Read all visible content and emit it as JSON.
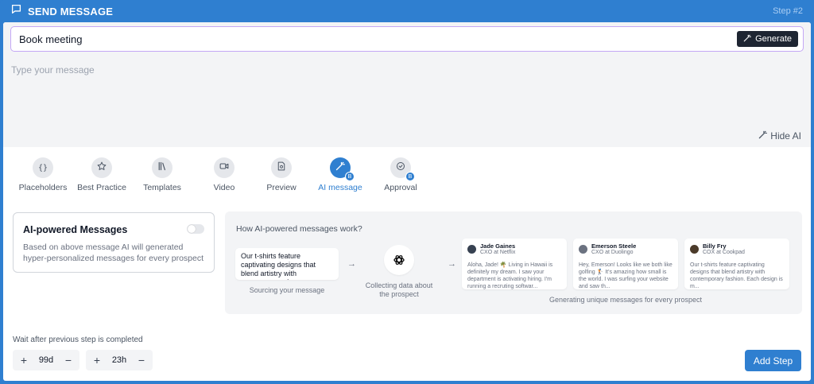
{
  "header": {
    "title": "SEND MESSAGE",
    "step": "Step #2"
  },
  "subject": {
    "value": "Book meeting",
    "generate_label": "Generate"
  },
  "message": {
    "placeholder": "Type your message"
  },
  "hide_ai_label": "Hide AI",
  "tools": [
    {
      "label": "Placeholders",
      "icon": "braces-icon"
    },
    {
      "label": "Best Practice",
      "icon": "star-icon"
    },
    {
      "label": "Templates",
      "icon": "library-icon"
    },
    {
      "label": "Video",
      "icon": "video-icon"
    },
    {
      "label": "Preview",
      "icon": "document-search-icon"
    },
    {
      "label": "AI message",
      "icon": "magic-wand-icon",
      "active": true,
      "badge": "B"
    },
    {
      "label": "Approval",
      "icon": "check-circle-icon",
      "badge": "B"
    }
  ],
  "ai_card": {
    "title": "AI-powered Messages",
    "description": "Based on above message AI will generated hyper-personalized messages for every prospect"
  },
  "how": {
    "title": "How AI-powered messages work?",
    "source_text": "Our t-shirts feature captivating designs that blend artistry with contemporary f...",
    "source_caption": "Sourcing your message",
    "collect_caption": "Collecting data about the prospect",
    "generate_caption": "Generating unique messages for every prospect",
    "prospects": [
      {
        "name": "Jade Gaines",
        "role": "CXO at Netflix",
        "body": "Aloha, Jade! 🌴 Living in Hawaii is definitely my dream. I saw your department is activating hiring. I'm running a recruting softwar..."
      },
      {
        "name": "Emerson Steele",
        "role": "CXO at Duolingo",
        "body": "Hey, Emerson! Looks like we both like golfing 🏌 It's amazing how small is the world. I was surfing your website and saw th..."
      },
      {
        "name": "Billy Fry",
        "role": "COX at Cookpad",
        "body": "Our t-shirts feature captivating designs that blend artistry with contemporary fashion. Each design is m..."
      }
    ]
  },
  "wait": {
    "label": "Wait after previous step is completed",
    "days": "99d",
    "hours": "23h"
  },
  "add_step_label": "Add Step",
  "colors": {
    "accent": "#2f7fd0",
    "dark_button": "#1e2532",
    "subject_border": "#c4a7f5"
  }
}
